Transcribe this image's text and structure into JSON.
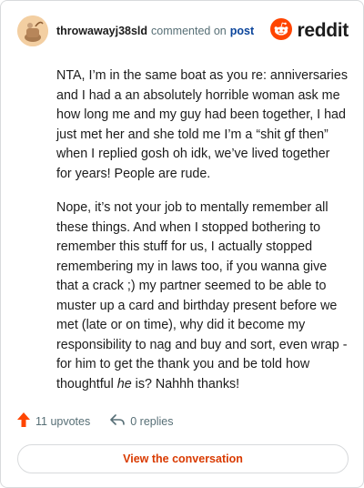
{
  "header": {
    "username": "throwawayj38sld",
    "commented_text": "commented on",
    "post_link": "post",
    "brand_word": "reddit",
    "avatar_icon": "avatar-icon",
    "brand_icon": "reddit-snoo-icon"
  },
  "comment": {
    "paragraph_1": "NTA, I’m in the same boat as you re: anniversaries and I had a an absolutely horrible woman ask me how long me and my guy had been together, I had just met her and she told me I’m a “shit gf then” when I replied gosh oh idk, we’ve lived together for years! People are rude.",
    "paragraph_2_before": "Nope, it’s not your job to mentally remember all these things. And when I stopped bothering to remember this stuff for us, I actually stopped remembering my in laws too, if you wanna give that a crack ;) my partner seemed to be able to muster up a card and birthday present before we met (late or on time), why did it become my responsibility to nag and buy and sort, even wrap - for him to get the thank you and be told how thoughtful ",
    "paragraph_2_emphasis": "he",
    "paragraph_2_after": " is? Nahhh thanks!"
  },
  "actions": {
    "upvotes_label": "11 upvotes",
    "replies_label": "0 replies",
    "upvote_icon": "upvote-arrow-icon",
    "reply_icon": "reply-arrow-icon"
  },
  "cta": {
    "label": "View the conversation"
  },
  "colors": {
    "accent": "#d93a00",
    "brand": "#ff4500",
    "link": "#0a449b",
    "muted": "#576f76",
    "border": "#d8dadc"
  }
}
